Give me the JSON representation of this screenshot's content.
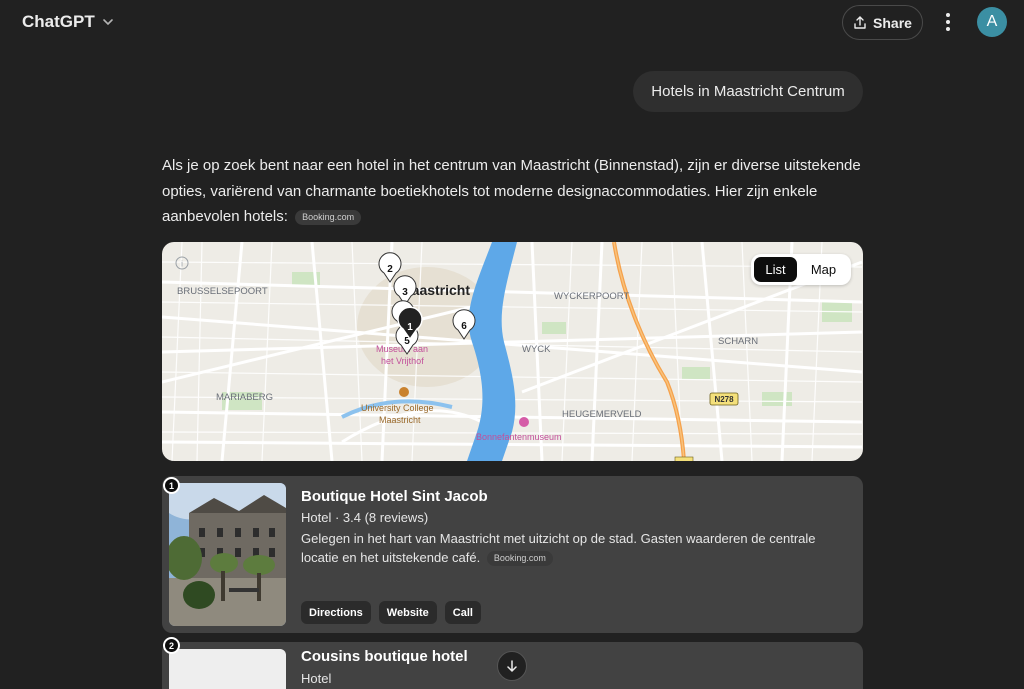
{
  "header": {
    "app_name": "ChatGPT",
    "share_label": "Share",
    "avatar_initial": "A"
  },
  "user_message": "Hotels in Maastricht Centrum",
  "answer": {
    "text": "Als je op zoek bent naar een hotel in het centrum van Maastricht (Binnenstad), zijn er diverse uitstekende opties, variërend van charmante boetiekhotels tot moderne designaccommodaties. Hier zijn enkele aanbevolen hotels:",
    "source": "Booking.com"
  },
  "map": {
    "toggle": {
      "list_label": "List",
      "map_label": "Map",
      "selected": "List"
    },
    "labels": {
      "city": "Maastricht",
      "brusselsepoort": "BRUSSELSEPOORT",
      "wyckerpoort": "WYCKERPOORT",
      "wyck": "WYCK",
      "scharn": "SCHARN",
      "mariaberg": "MARIABERG",
      "heugemerveld": "HEUGEMERVELD",
      "road": "N278",
      "museum_line1": "Museum aan",
      "museum_line2": "het Vrijthof",
      "university_line1": "University College",
      "university_line2": "Maastricht",
      "bonnefanten": "Bonnefantenmuseum"
    },
    "pins": [
      "1",
      "2",
      "3",
      "4",
      "5",
      "6"
    ]
  },
  "hotels": [
    {
      "number": "1",
      "name": "Boutique Hotel Sint Jacob",
      "meta": "Hotel · 3.4 (8 reviews)",
      "description": "Gelegen in het hart van Maastricht met uitzicht op de stad. Gasten waarderen de centrale locatie en het uitstekende café.",
      "source": "Booking.com",
      "actions": [
        "Directions",
        "Website",
        "Call"
      ]
    },
    {
      "number": "2",
      "name": "Cousins boutique hotel",
      "meta": "Hotel"
    }
  ],
  "colors": {
    "background": "#212121",
    "bubble": "#2f2f2f",
    "card": "#424242",
    "avatar": "#3b8fa3",
    "river": "#5ea8e8",
    "highway": "#f5a14b"
  }
}
